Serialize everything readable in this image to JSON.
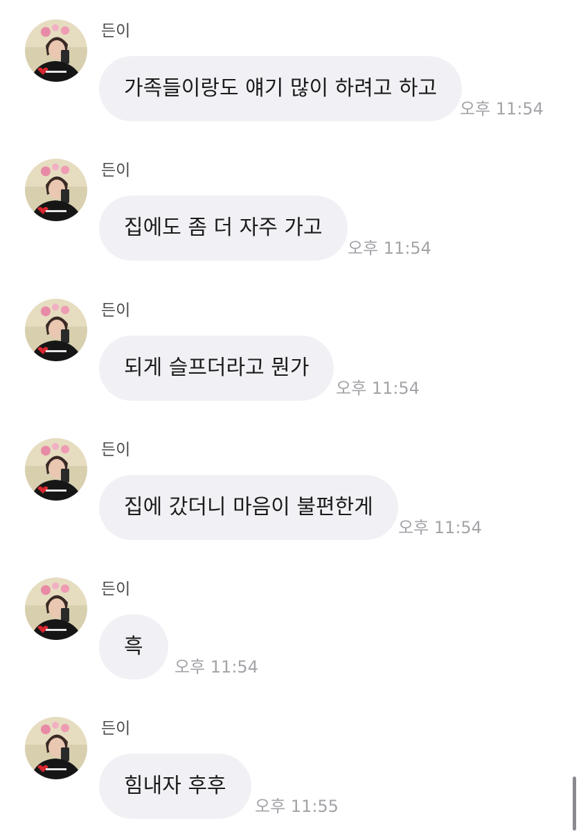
{
  "messages": [
    {
      "sender": "든이",
      "text": "가족들이랑도 얘기 많이 하려고 하고",
      "time": "오후 11:54",
      "avatar_icon": "profile-photo"
    },
    {
      "sender": "든이",
      "text": "집에도 좀 더 자주 가고",
      "time": "오후 11:54",
      "avatar_icon": "profile-photo"
    },
    {
      "sender": "든이",
      "text": "되게 슬프더라고 뭔가",
      "time": "오후 11:54",
      "avatar_icon": "profile-photo"
    },
    {
      "sender": "든이",
      "text": "집에 갔더니 마음이 불편한게",
      "time": "오후 11:54",
      "avatar_icon": "profile-photo"
    },
    {
      "sender": "든이",
      "text": "흑",
      "time": "오후 11:54",
      "avatar_icon": "profile-photo"
    },
    {
      "sender": "든이",
      "text": "힘내자 후후",
      "time": "오후 11:55",
      "avatar_icon": "profile-photo"
    }
  ],
  "colors": {
    "bubble_bg": "#f1f1f5",
    "time_text": "#a3a3a8",
    "sender_text": "#4a4a4a",
    "message_text": "#1b1b1b"
  }
}
